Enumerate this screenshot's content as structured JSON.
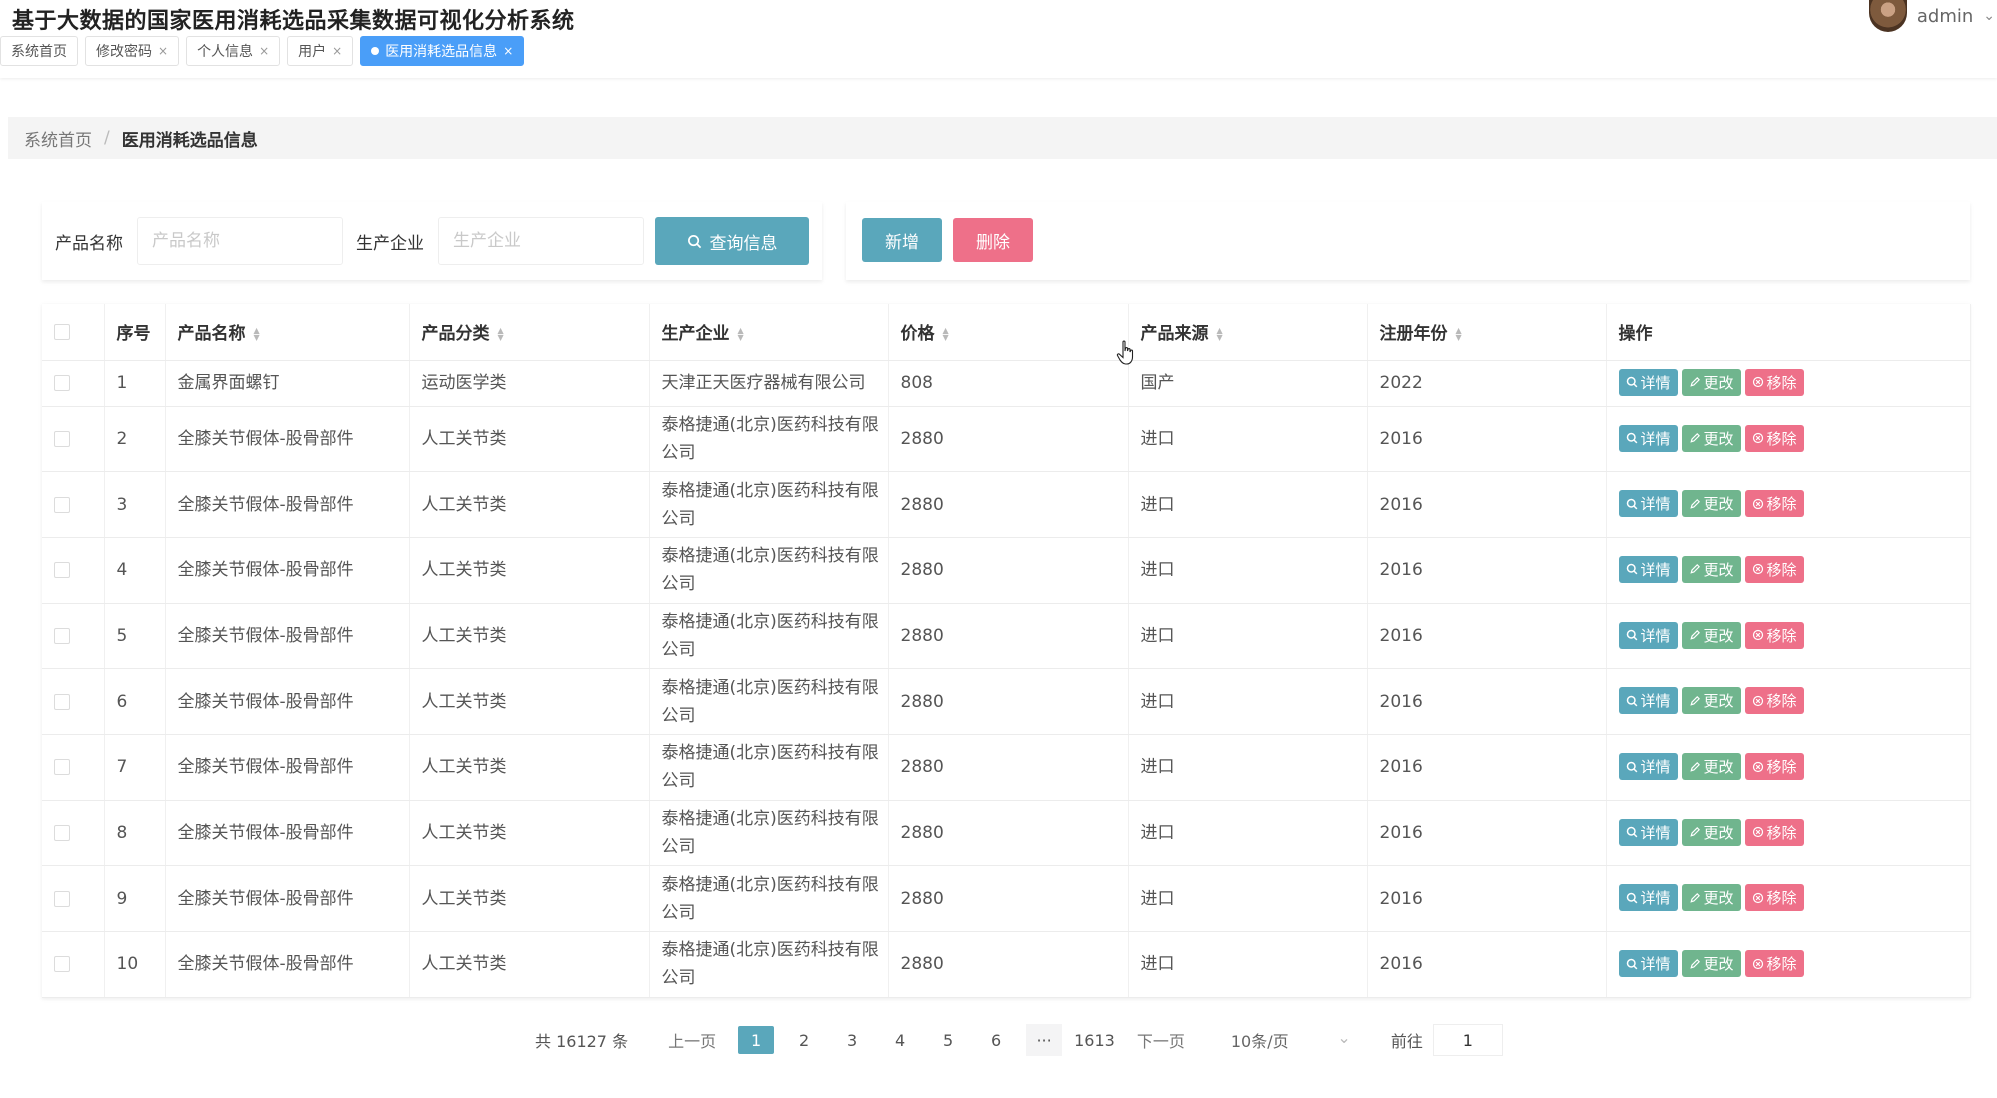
{
  "app": {
    "title": "基于大数据的国家医用消耗选品采集数据可视化分析系统"
  },
  "user": {
    "name": "admin"
  },
  "tabs": [
    {
      "label": "系统首页",
      "closable": false,
      "active": false
    },
    {
      "label": "修改密码",
      "closable": true,
      "active": false
    },
    {
      "label": "个人信息",
      "closable": true,
      "active": false
    },
    {
      "label": "用户",
      "closable": true,
      "active": false
    },
    {
      "label": "医用消耗选品信息",
      "closable": true,
      "active": true
    }
  ],
  "breadcrumb": {
    "home": "系统首页",
    "current": "医用消耗选品信息"
  },
  "search": {
    "product_name_label": "产品名称",
    "product_name_placeholder": "产品名称",
    "company_label": "生产企业",
    "company_placeholder": "生产企业",
    "button_label": "查询信息"
  },
  "actions": {
    "add_label": "新增",
    "delete_label": "删除"
  },
  "table": {
    "columns": [
      "序号",
      "产品名称",
      "产品分类",
      "生产企业",
      "价格",
      "产品来源",
      "注册年份",
      "操作"
    ],
    "rows": [
      [
        "1",
        "金属界面螺钉",
        "运动医学类",
        "天津正天医疗器械有限公司",
        "808",
        "国产",
        "2022"
      ],
      [
        "2",
        "全膝关节假体-股骨部件",
        "人工关节类",
        "泰格捷通(北京)医药科技有限公司",
        "2880",
        "进口",
        "2016"
      ],
      [
        "3",
        "全膝关节假体-股骨部件",
        "人工关节类",
        "泰格捷通(北京)医药科技有限公司",
        "2880",
        "进口",
        "2016"
      ],
      [
        "4",
        "全膝关节假体-股骨部件",
        "人工关节类",
        "泰格捷通(北京)医药科技有限公司",
        "2880",
        "进口",
        "2016"
      ],
      [
        "5",
        "全膝关节假体-股骨部件",
        "人工关节类",
        "泰格捷通(北京)医药科技有限公司",
        "2880",
        "进口",
        "2016"
      ],
      [
        "6",
        "全膝关节假体-股骨部件",
        "人工关节类",
        "泰格捷通(北京)医药科技有限公司",
        "2880",
        "进口",
        "2016"
      ],
      [
        "7",
        "全膝关节假体-股骨部件",
        "人工关节类",
        "泰格捷通(北京)医药科技有限公司",
        "2880",
        "进口",
        "2016"
      ],
      [
        "8",
        "全膝关节假体-股骨部件",
        "人工关节类",
        "泰格捷通(北京)医药科技有限公司",
        "2880",
        "进口",
        "2016"
      ],
      [
        "9",
        "全膝关节假体-股骨部件",
        "人工关节类",
        "泰格捷通(北京)医药科技有限公司",
        "2880",
        "进口",
        "2016"
      ],
      [
        "10",
        "全膝关节假体-股骨部件",
        "人工关节类",
        "泰格捷通(北京)医药科技有限公司",
        "2880",
        "进口",
        "2016"
      ]
    ],
    "row_actions": {
      "detail": "详情",
      "edit": "更改",
      "remove": "移除"
    }
  },
  "pagination": {
    "total": "共 16127 条",
    "prev": "上一页",
    "next": "下一页",
    "pages": [
      "1",
      "2",
      "3",
      "4",
      "5",
      "6"
    ],
    "more": "···",
    "last": "1613",
    "page_size": "10条/页",
    "goto_label": "前往",
    "goto_value": "1"
  },
  "colors": {
    "primary": "#5aa7bb",
    "edit": "#70b58e",
    "danger": "#ee7089",
    "active_tab": "#4a9ef8"
  }
}
